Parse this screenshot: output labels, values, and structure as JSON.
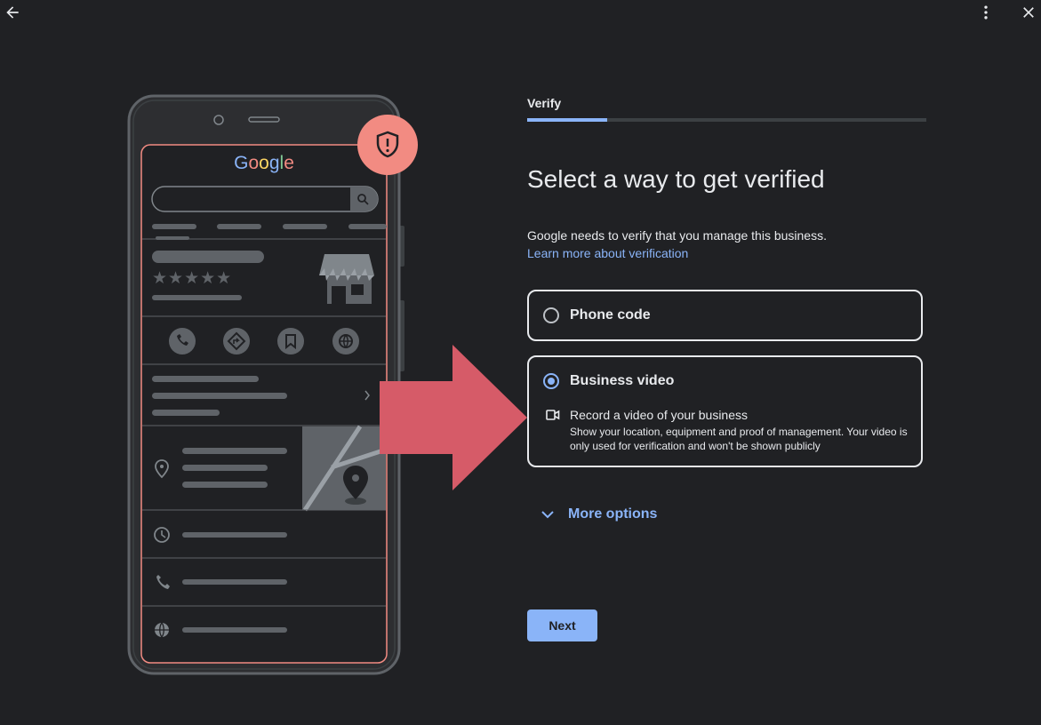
{
  "topbar": {
    "back_icon": "arrow-left-icon",
    "menu_icon": "more-vert-icon",
    "close_icon": "close-icon"
  },
  "illustration": {
    "brand": "Google",
    "rating_stars": "★★★★★",
    "shield_color": "#f28b82",
    "phone_outline_color": "#f28b82"
  },
  "step": {
    "label": "Verify",
    "progress": 0.2
  },
  "main": {
    "title": "Select a way to get verified",
    "description": "Google needs to verify that you manage this business.",
    "learn_link": "Learn more about verification"
  },
  "options": [
    {
      "label": "Phone code",
      "selected": false
    },
    {
      "label": "Business video",
      "selected": true,
      "detail_title": "Record a video of your business",
      "detail_desc": "Show your location, equipment and proof of management. Your video is only used for verification and won't be shown publicly"
    }
  ],
  "more_options": "More options",
  "next_label": "Next",
  "colors": {
    "accent": "#8ab4f8",
    "background": "#202124",
    "highlight_arrow": "#d65b68"
  }
}
